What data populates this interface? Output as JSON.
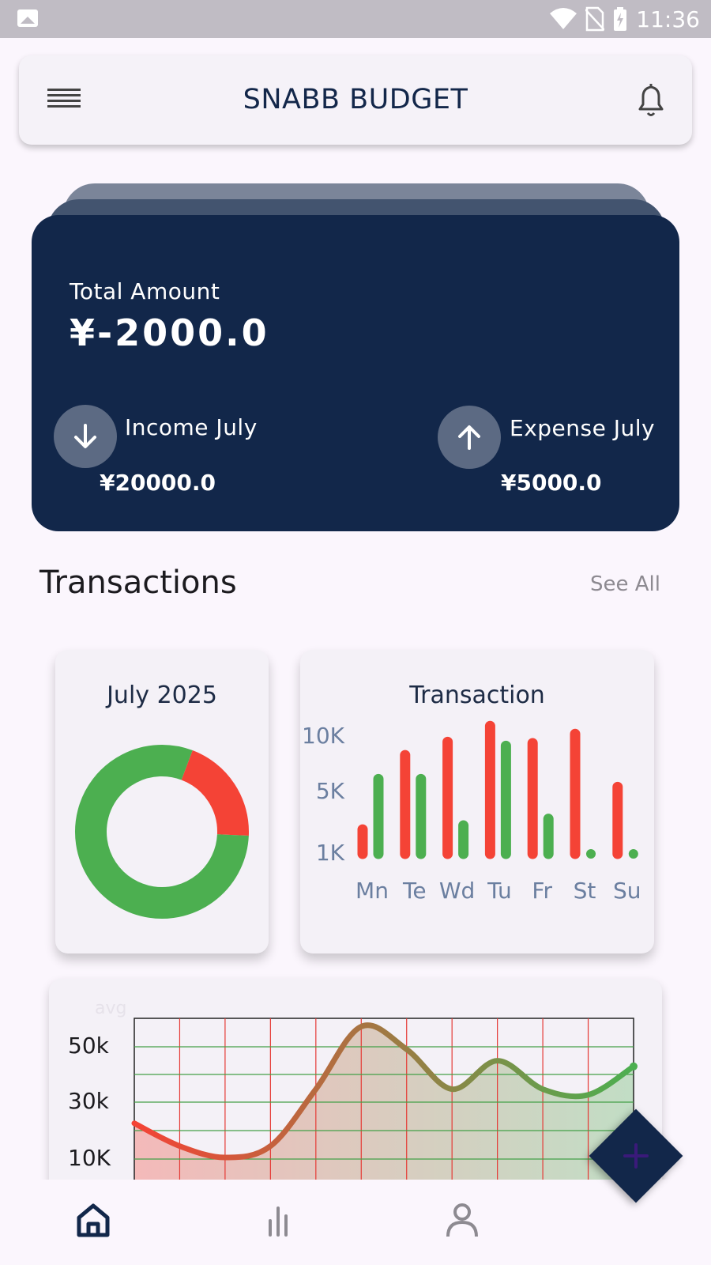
{
  "status_bar": {
    "time": "11:36",
    "icons": [
      "image-icon",
      "wifi-icon",
      "no-sim-icon",
      "battery-charging-icon"
    ]
  },
  "app_bar": {
    "title": "SNABB BUDGET",
    "left_icon": "menu-icon",
    "right_icon": "bell-icon"
  },
  "balance_card": {
    "label": "Total Amount",
    "amount": "¥-2000.0",
    "income": {
      "label": "Income July",
      "value": "¥20000.0",
      "icon": "arrow-down-icon"
    },
    "expense": {
      "label": "Expense July",
      "value": "¥5000.0",
      "icon": "arrow-up-icon"
    }
  },
  "transactions": {
    "title": "Transactions",
    "see_all": "See All"
  },
  "colors": {
    "navy": "#12274a",
    "income_green": "#4caf50",
    "expense_red": "#f44336",
    "axis_label": "#6b7fa0"
  },
  "donut_card": {
    "title": "July 2025",
    "chart_data": {
      "type": "pie",
      "slices": [
        {
          "color": "#f44336",
          "value": 20
        },
        {
          "color": "#4caf50",
          "value": 80
        }
      ]
    }
  },
  "bar_card": {
    "title": "Transaction",
    "chart_data": {
      "type": "bar",
      "categories": [
        "Mn",
        "Te",
        "Wd",
        "Tu",
        "Fr",
        "St",
        "Su"
      ],
      "y_ticks": [
        "10K",
        "5K",
        "1K"
      ],
      "ylim": [
        1000,
        10000
      ],
      "series": [
        {
          "color": "#f44336",
          "values": [
            3200,
            8800,
            9800,
            11000,
            9700,
            10400,
            6400
          ]
        },
        {
          "color": "#4caf50",
          "values": [
            7000,
            7000,
            3500,
            9500,
            4000,
            1000,
            1000
          ]
        }
      ]
    }
  },
  "line_card": {
    "chart_data": {
      "type": "area",
      "label": "avg",
      "y_ticks": [
        "50k",
        "30k",
        "10K"
      ],
      "x": [
        0,
        1,
        2,
        3,
        4,
        5,
        6,
        7,
        8,
        9,
        10,
        11
      ],
      "y": [
        31,
        27,
        25,
        27,
        37,
        48,
        44,
        37,
        42,
        37,
        36,
        41
      ]
    }
  },
  "bottom_nav": {
    "items": [
      {
        "icon": "home-icon",
        "active": true
      },
      {
        "icon": "stats-icon",
        "active": false
      },
      {
        "icon": "profile-icon",
        "active": false
      }
    ]
  },
  "fab": {
    "icon": "plus-icon"
  }
}
